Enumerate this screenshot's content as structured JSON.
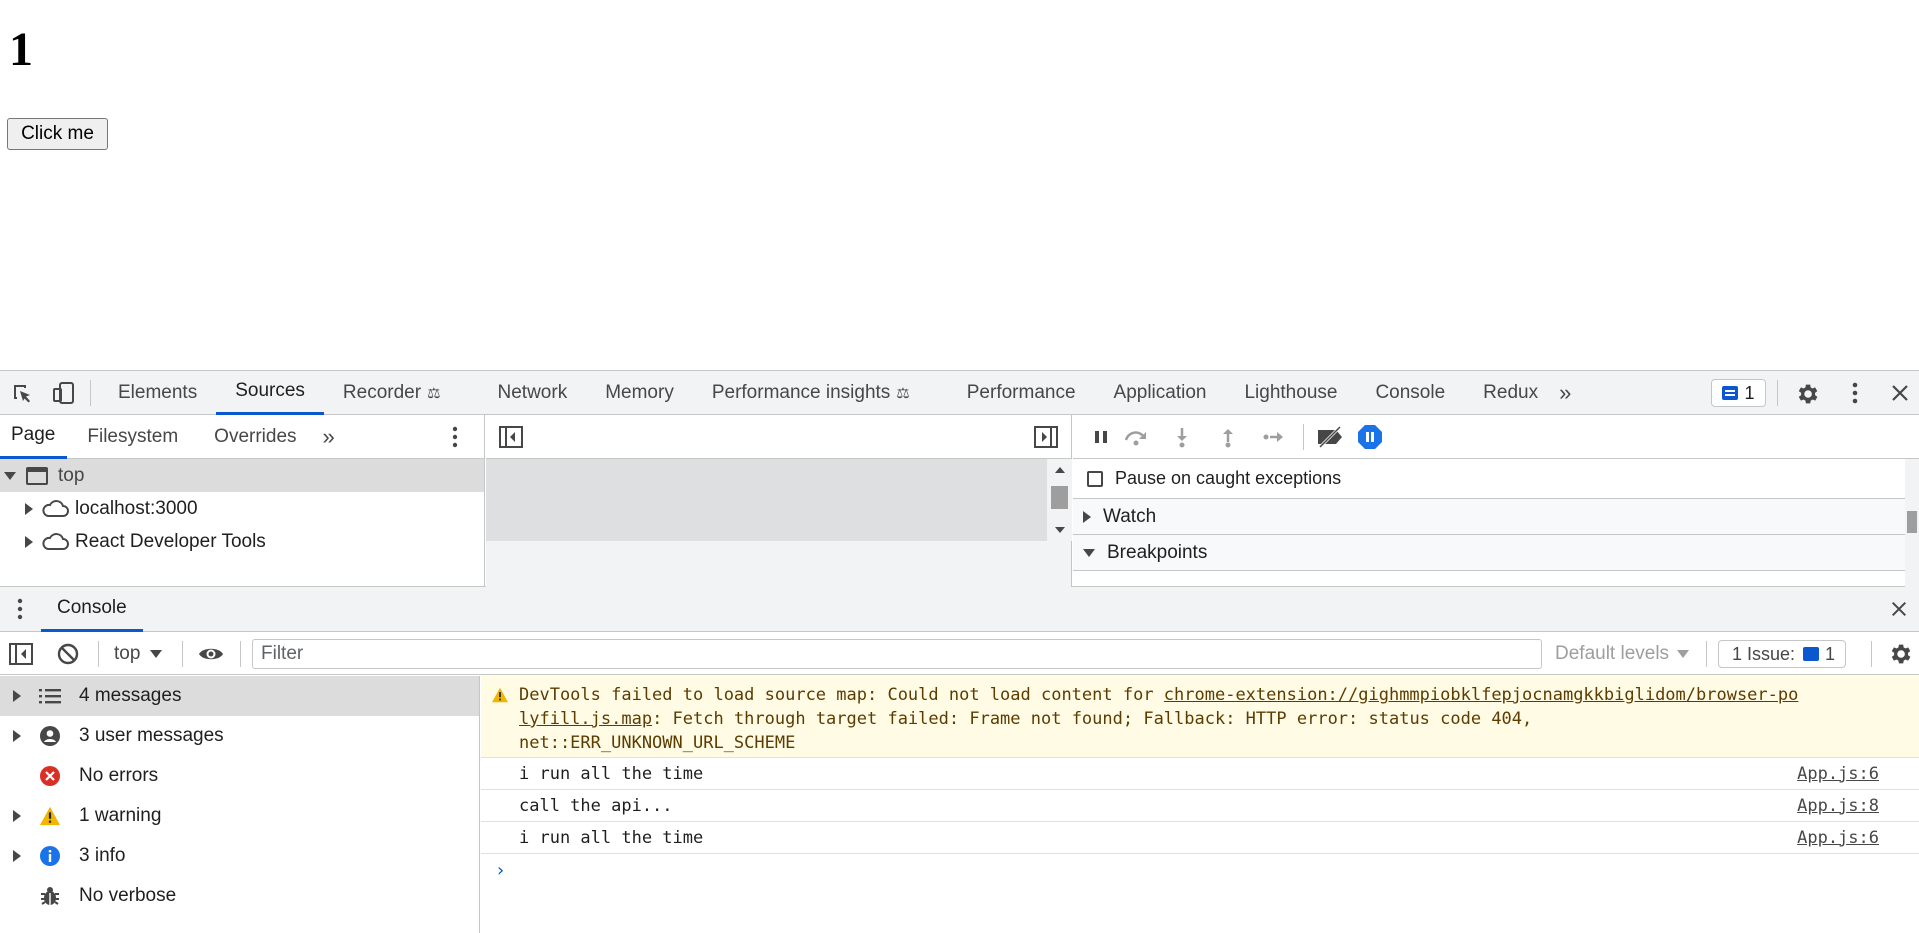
{
  "page": {
    "counter": "1",
    "button_label": "Click me"
  },
  "devtools": {
    "main_tabs": [
      {
        "label": "Elements"
      },
      {
        "label": "Sources",
        "active": true
      },
      {
        "label": "Recorder"
      },
      {
        "label": "Network"
      },
      {
        "label": "Memory"
      },
      {
        "label": "Performance insights"
      },
      {
        "label": "Performance"
      },
      {
        "label": "Application"
      },
      {
        "label": "Lighthouse"
      },
      {
        "label": "Console"
      },
      {
        "label": "Redux"
      }
    ],
    "issue_count": "1",
    "sources": {
      "nav_tabs": [
        "Page",
        "Filesystem",
        "Overrides"
      ],
      "tree": [
        "top",
        "localhost:3000",
        "React Developer Tools"
      ],
      "pause_on_caught": "Pause on caught exceptions",
      "sections": [
        "Watch",
        "Breakpoints"
      ]
    },
    "drawer": {
      "tab": "Console",
      "context": "top",
      "filter_placeholder": "Filter",
      "levels": "Default levels",
      "issues_label": "1 Issue:",
      "issues_count": "1",
      "sidebar": [
        {
          "label": "4 messages",
          "icon": "list-icon"
        },
        {
          "label": "3 user messages",
          "icon": "user-icon"
        },
        {
          "label": "No errors",
          "icon": "error-icon"
        },
        {
          "label": "1 warning",
          "icon": "warning-icon"
        },
        {
          "label": "3 info",
          "icon": "info-icon"
        },
        {
          "label": "No verbose",
          "icon": "bug-icon"
        }
      ],
      "warning": {
        "prefix": "DevTools failed to load source map: Could not load content for ",
        "link1": "chrome-extension://gighmmpiobklfepjocnamgkkbiglidom/browser-po",
        "link2": "lyfill.js.map",
        "suffix1": ": Fetch through target failed: Frame not found; Fallback: HTTP error: status code 404,",
        "suffix2": "net::ERR_UNKNOWN_URL_SCHEME"
      },
      "messages": [
        {
          "text": "i run all the time",
          "source": "App.js:6"
        },
        {
          "text": "call the api...",
          "source": "App.js:8"
        },
        {
          "text": "i run all the time",
          "source": "App.js:6"
        }
      ],
      "colors": {
        "accent": "#0b57d0",
        "warning_bg": "#fffbe5",
        "error": "#d93025",
        "warning": "#f2b600",
        "info": "#1a73e8"
      }
    }
  }
}
